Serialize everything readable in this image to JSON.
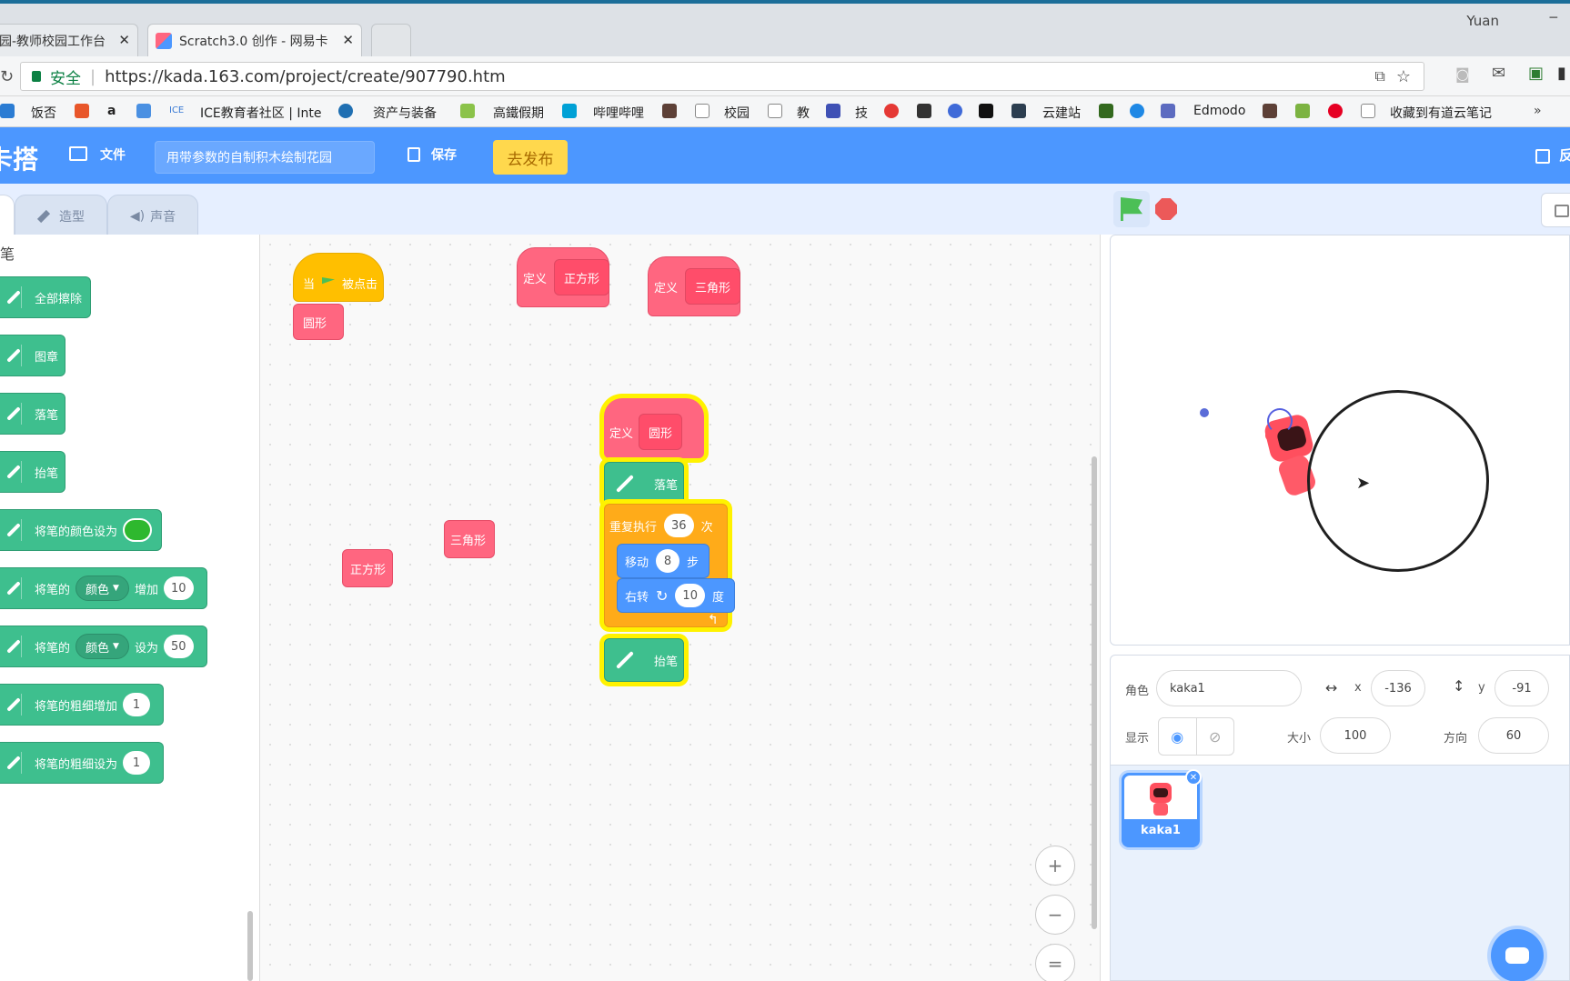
{
  "browser": {
    "user": "Yuan",
    "minimize": "─",
    "tabs": [
      {
        "title": "园-教师校园工作台",
        "close": "✕"
      },
      {
        "title": "Scratch3.0 创作 - 网易卡",
        "close": "✕"
      }
    ],
    "secure_label": "安全",
    "url": "https://kada.163.com/project/create/907790.htm",
    "bookmarks": [
      "饭否",
      "a",
      "ICE",
      "ICE教育者社区 | Inte",
      "资产与装备",
      "高鐵假期",
      "哔哩哔哩",
      "校园",
      "教",
      "技",
      "云建站",
      "Edmodo",
      "收藏到有道云笔记",
      "»"
    ]
  },
  "app": {
    "logo": "卡搭",
    "file_label": "文件",
    "project_title": "用带参数的自制积木绘制花园",
    "save_label": "保存",
    "publish_label": "去发布",
    "right_label": "反"
  },
  "tabs": {
    "costumes": "造型",
    "sounds": "声音"
  },
  "palette": {
    "category": "笔",
    "blocks": {
      "clear": "全部擦除",
      "stamp": "图章",
      "pen_down": "落笔",
      "pen_up": "抬笔",
      "set_color_prefix": "将笔的颜色设为",
      "change_prefix": "将笔的",
      "change_menu": "颜色",
      "change_mid": "增加",
      "change_val": "10",
      "set_prefix": "将笔的",
      "set_menu": "颜色",
      "set_mid": "设为",
      "set_val": "50",
      "change_size": "将笔的粗细增加",
      "change_size_val": "1",
      "set_size": "将笔的粗细设为",
      "set_size_val": "1"
    }
  },
  "script": {
    "when_prefix": "当",
    "when_suffix": "被点击",
    "call_circle": "圆形",
    "define": "定义",
    "square": "正方形",
    "triangle": "三角形",
    "circle": "圆形",
    "loose_square": "正方形",
    "loose_triangle": "三角形",
    "pen_down": "落笔",
    "repeat": "重复执行",
    "repeat_count": "36",
    "repeat_suffix": "次",
    "move": "移动",
    "move_val": "8",
    "move_suffix": "步",
    "turn": "右转",
    "turn_val": "10",
    "turn_suffix": "度",
    "pen_up": "抬笔",
    "zoom_in": "+",
    "zoom_out": "−",
    "zoom_reset": "="
  },
  "sprite": {
    "label": "角色",
    "name": "kaka1",
    "x_label": "x",
    "x": "-136",
    "y_label": "y",
    "y": "-91",
    "show_label": "显示",
    "size_label": "大小",
    "size": "100",
    "dir_label": "方向",
    "dir": "60",
    "thumb_name": "kaka1"
  },
  "colors": {
    "accent": "#4c97ff",
    "pen": "#3ebf8e",
    "custom": "#ff6680",
    "control": "#ffab19",
    "event": "#ffbf00",
    "publish": "#ffd84d"
  },
  "icons": [
    "folder-icon",
    "save-icon",
    "brush-icon",
    "speaker-icon",
    "green-flag-icon",
    "stop-icon",
    "eye-icon",
    "eye-off-icon",
    "zoom-in-icon",
    "zoom-out-icon",
    "robot-icon",
    "pen-icon"
  ]
}
